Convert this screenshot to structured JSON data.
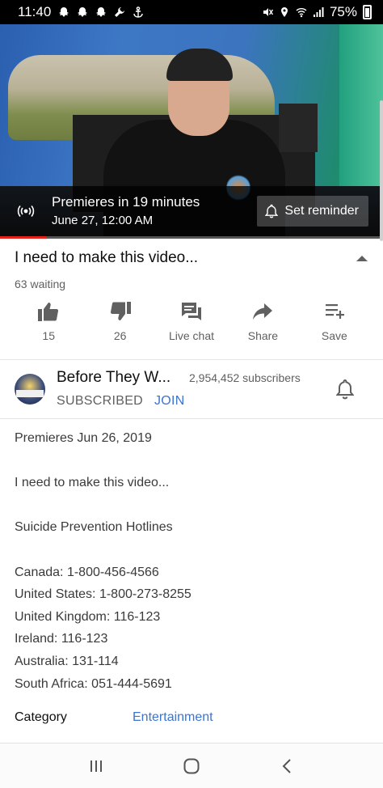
{
  "status_bar": {
    "time": "11:40",
    "battery": "75%",
    "left_icons": [
      "snapchat-icon",
      "snapchat-icon",
      "snapchat-icon",
      "wrench-icon",
      "anchor-icon"
    ],
    "right_icons": [
      "mute-icon",
      "location-icon",
      "wifi-icon",
      "signal-icon",
      "battery-icon"
    ]
  },
  "player": {
    "premiere_title": "Premieres in 19 minutes",
    "premiere_date": "June 27, 12:00 AM",
    "reminder_label": "Set reminder",
    "progress_fraction": 0.12
  },
  "video": {
    "title": "I need to make this video...",
    "waiting": "63 waiting"
  },
  "actions": [
    {
      "icon": "thumbs-up-icon",
      "label": "15"
    },
    {
      "icon": "thumbs-down-icon",
      "label": "26"
    },
    {
      "icon": "live-chat-icon",
      "label": "Live chat"
    },
    {
      "icon": "share-icon",
      "label": "Share"
    },
    {
      "icon": "save-playlist-icon",
      "label": "Save"
    }
  ],
  "channel": {
    "name": "Before They W...",
    "subscribers": "2,954,452 subscribers",
    "subscribed_label": "SUBSCRIBED",
    "join_label": "JOIN"
  },
  "description": {
    "premiere_line": "Premieres Jun 26, 2019",
    "summary": "I need to make this video...",
    "hotlines_heading": "Suicide Prevention Hotlines",
    "hotlines": [
      "Canada:  1-800-456-4566",
      "United States:  1-800-273-8255",
      "United Kingdom: 116-123",
      "Ireland:  116-123",
      "Australia:  131-114",
      "South Africa: 051-444-5691"
    ]
  },
  "category": {
    "label": "Category",
    "value": "Entertainment"
  },
  "colors": {
    "accent_red": "#e62117",
    "link_blue": "#3b75d0",
    "secondary_text": "#606060"
  }
}
